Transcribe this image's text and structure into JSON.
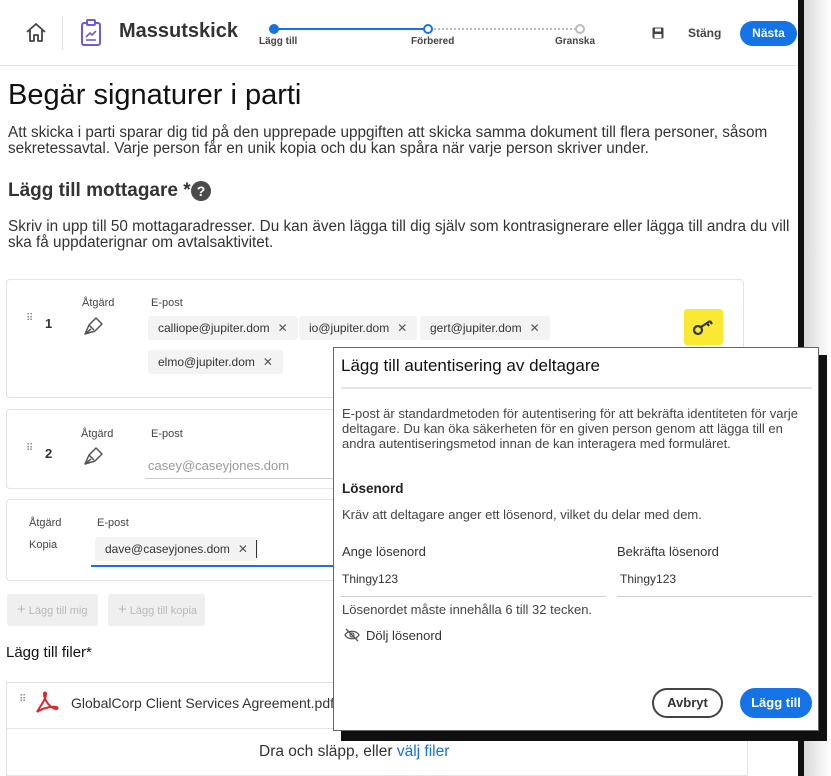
{
  "header": {
    "app_title": "Massutskick",
    "steps": [
      "Lägg till",
      "Förbered",
      "Granska"
    ],
    "close_label": "Stäng",
    "next_label": "Nästa"
  },
  "main": {
    "title": "Begär signaturer i parti",
    "description": "Att skicka i parti sparar dig tid på den upprepade uppgiften att skicka samma dokument till flera personer, såsom sekretessavtal. Varje person får en unik kopia och du kan spåra när varje person skriver under.",
    "recipients_title": "Lägg till mottagare *",
    "help_glyph": "?",
    "recipients_desc": "Skriv in upp till 50 mottagaradresser. Du kan även lägga till dig själv som kontrasignerare eller lägga till andra du vill ska få uppdaterignar om avtalsaktivitet."
  },
  "recipients": [
    {
      "number": "1",
      "action_label": "Åtgärd",
      "email_label": "E-post",
      "emails": [
        "calliope@jupiter.dom",
        "io@jupiter.dom",
        "gert@jupiter.dom",
        "elmo@jupiter.dom"
      ]
    },
    {
      "number": "2",
      "action_label": "Åtgärd",
      "email_label": "E-post",
      "placeholder": "casey@caseyjones.dom"
    },
    {
      "action_label": "Åtgärd",
      "action_value": "Kopia",
      "email_label": "E-post",
      "emails": [
        "dave@caseyjones.dom"
      ]
    }
  ],
  "buttons": {
    "add_me": "Lägg till mig",
    "add_copy": "Lägg till kopia"
  },
  "files": {
    "title": "Lägg till filer*",
    "file_name": "GlobalCorp Client Services Agreement.pdf",
    "drop_text": "Dra och släpp, eller ",
    "drop_link": "välj filer"
  },
  "dialog": {
    "title": "Lägg till autentisering av deltagare",
    "body": "E-post är standardmetoden för autentisering för att bekräfta identiteten för varje deltagare. Du kan öka säkerheten för en given person genom att lägga till en andra autentiseringsmetod innan de kan interagera med formuläret.",
    "password_heading": "Lösenord",
    "password_text": "Kräv att deltagare anger ett lösenord, vilket du delar med dem.",
    "enter_label": "Ange lösenord",
    "enter_value": "Thingy123",
    "confirm_label": "Bekräfta lösenord",
    "confirm_value": "Thingy123",
    "hint": "Lösenordet måste innehålla 6 till 32 tecken.",
    "toggle_label": "Dölj lösenord",
    "cancel_label": "Avbryt",
    "add_label": "Lägg till"
  },
  "colors": {
    "accent": "#1473e6",
    "key_highlight": "#f9e933",
    "pdf_red": "#e3242b"
  },
  "icons": [
    "home-icon",
    "document-icon",
    "save-icon",
    "help-icon",
    "drag-handle-icon",
    "pen-icon",
    "close-icon",
    "key-icon",
    "plus-icon",
    "pdf-icon",
    "eye-off-icon"
  ]
}
